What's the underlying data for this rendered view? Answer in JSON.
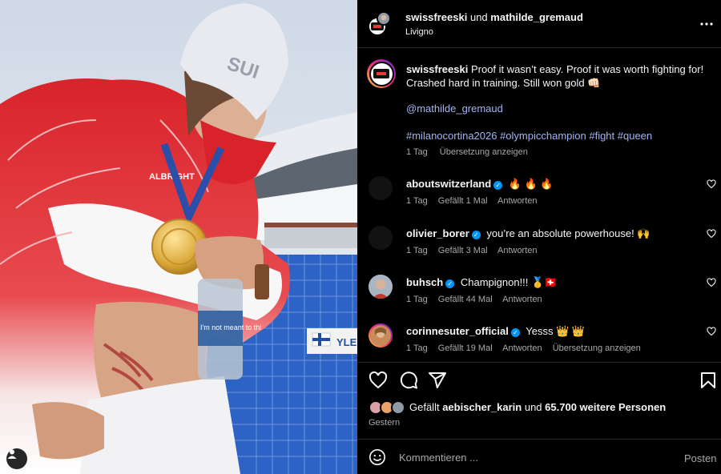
{
  "header": {
    "user1": "swissfreeski",
    "joiner": "und",
    "user2": "mathilde_gremaud",
    "location": "Livigno"
  },
  "photo": {
    "hat_text": "SUI",
    "jacket_brand": "ALBRIGHT",
    "bottle_text": "I'm not meant to thi",
    "banner_text": "YLE"
  },
  "caption": {
    "username": "swissfreeski",
    "text": "Proof it wasn’t easy. Proof it was worth fighting for! Crashed hard in training. Still won gold 👊🏻",
    "mention": "@mathilde_gremaud",
    "hashtags": "#milanocortina2026 #olympicchampion #fight #queen",
    "time": "1 Tag",
    "translate": "Übersetzung anzeigen"
  },
  "comments": [
    {
      "user": "aboutswitzerland",
      "text": "🔥 🔥 🔥",
      "time": "1 Tag",
      "likes": "Gefällt 1 Mal",
      "reply": "Antworten",
      "translate": ""
    },
    {
      "user": "olivier_borer",
      "text": "you’re an absolute powerhouse! 🙌",
      "time": "1 Tag",
      "likes": "Gefällt 3 Mal",
      "reply": "Antworten",
      "translate": ""
    },
    {
      "user": "buhsch",
      "text": "Champignon!!! 🥇🇨🇭",
      "time": "1 Tag",
      "likes": "Gefällt 44 Mal",
      "reply": "Antworten",
      "translate": ""
    },
    {
      "user": "corinnesuter_official",
      "text": "Yesss 👑 👑",
      "time": "1 Tag",
      "likes": "Gefällt 19 Mal",
      "reply": "Antworten",
      "translate": "Übersetzung anzeigen"
    }
  ],
  "likes": {
    "prefix": "Gefällt",
    "user": "aebischer_karin",
    "middle": "und",
    "count": "65.700 weitere Personen"
  },
  "date": "Gestern",
  "comment_bar": {
    "placeholder": "Kommentieren ...",
    "post": "Posten"
  },
  "colors": {
    "background": "#000000",
    "link": "#a4b5f5",
    "muted": "#a8a8a8",
    "verified": "#0095f6"
  },
  "icons": [
    "more-icon",
    "heart-icon",
    "comment-icon",
    "share-icon",
    "bookmark-icon",
    "emoji-icon",
    "user-tag-icon",
    "verified-icon"
  ]
}
